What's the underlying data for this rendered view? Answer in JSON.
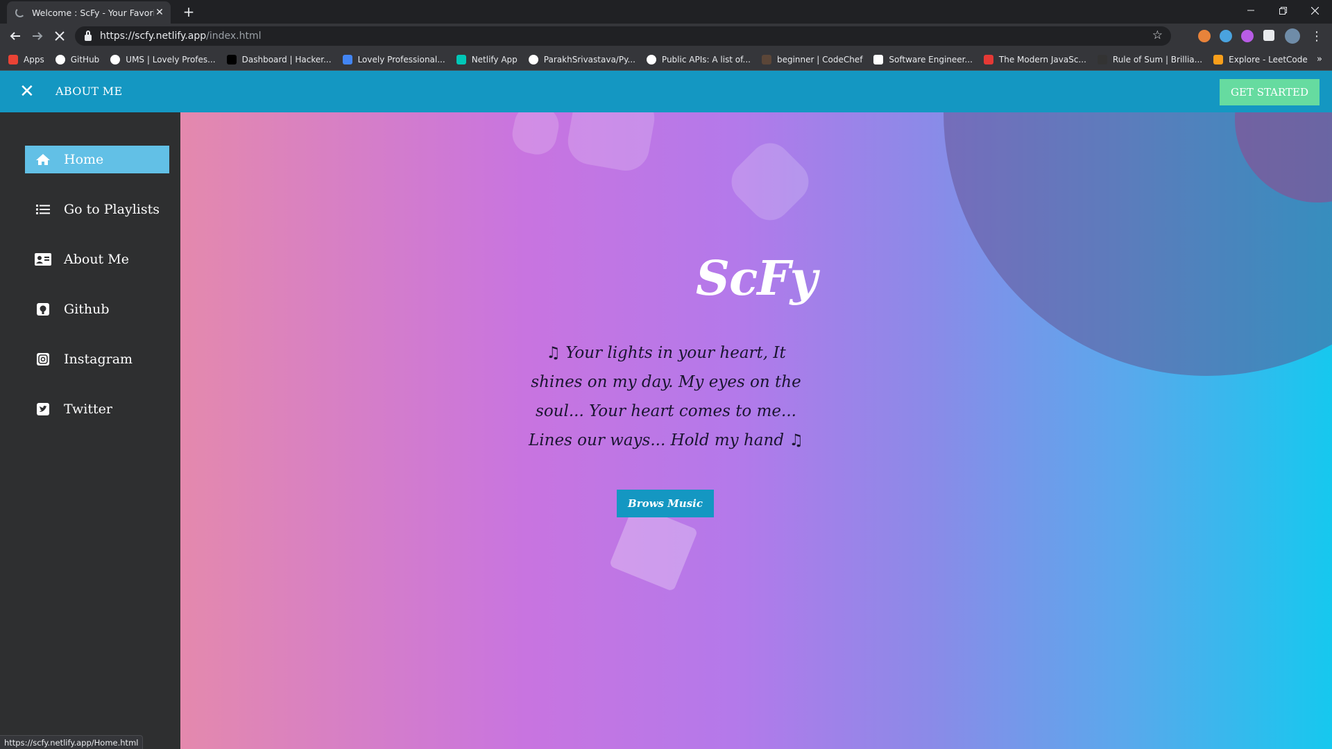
{
  "browser": {
    "tab_title": "Welcome : ScFy - Your Favorite M",
    "url_host": "https://scfy.netlify.app",
    "url_path": "/index.html",
    "new_tab_symbol": "+",
    "status_url": "https://scfy.netlify.app/Home.html"
  },
  "bookmarks": [
    {
      "label": "Apps",
      "icon": "apps-grid-icon",
      "color": "#ea4335"
    },
    {
      "label": "GitHub",
      "icon": "github-icon",
      "color": "#ffffff"
    },
    {
      "label": "UMS | Lovely Profes...",
      "icon": "globe-icon",
      "color": "#ffffff"
    },
    {
      "label": "Dashboard | Hacker...",
      "icon": "hackerrank-icon",
      "color": "#000000"
    },
    {
      "label": "Lovely Professional...",
      "icon": "infinity-icon",
      "color": "#4285f4"
    },
    {
      "label": "Netlify App",
      "icon": "netlify-icon",
      "color": "#00c7b7"
    },
    {
      "label": "ParakhSrivastava/Py...",
      "icon": "github-icon",
      "color": "#ffffff"
    },
    {
      "label": "Public APIs: A list of...",
      "icon": "publicapis-icon",
      "color": "#ffffff"
    },
    {
      "label": "beginner | CodeChef",
      "icon": "codechef-icon",
      "color": "#5b4638"
    },
    {
      "label": "Software Engineer...",
      "icon": "software-icon",
      "color": "#ffffff"
    },
    {
      "label": "The Modern JavaSc...",
      "icon": "javascript-icon",
      "color": "#e53935"
    },
    {
      "label": "Rule of Sum | Brillia...",
      "icon": "brilliant-icon",
      "color": "#333333"
    },
    {
      "label": "Explore - LeetCode",
      "icon": "leetcode-icon",
      "color": "#f89f1b"
    }
  ],
  "topbar": {
    "title": "ABOUT ME",
    "cta_label": "GET STARTED"
  },
  "sidebar": {
    "items": [
      {
        "label": "Home",
        "icon": "home-icon",
        "active": true
      },
      {
        "label": "Go to Playlists",
        "icon": "list-icon",
        "active": false
      },
      {
        "label": "About Me",
        "icon": "id-card-icon",
        "active": false
      },
      {
        "label": "Github",
        "icon": "github-icon",
        "active": false
      },
      {
        "label": "Instagram",
        "icon": "instagram-icon",
        "active": false
      },
      {
        "label": "Twitter",
        "icon": "twitter-icon",
        "active": false
      }
    ]
  },
  "hero": {
    "brand": "ScFy",
    "lyrics": "♫ Your lights in your heart, It shines on my day. My eyes on the soul... Your heart comes to me... Lines our ways... Hold my hand ♫",
    "button_label": "Brows Music"
  },
  "colors": {
    "topbar": "#1497c2",
    "cta": "#66dba0",
    "sidebar": "#2e2f30",
    "active_item": "#62c0e6"
  }
}
